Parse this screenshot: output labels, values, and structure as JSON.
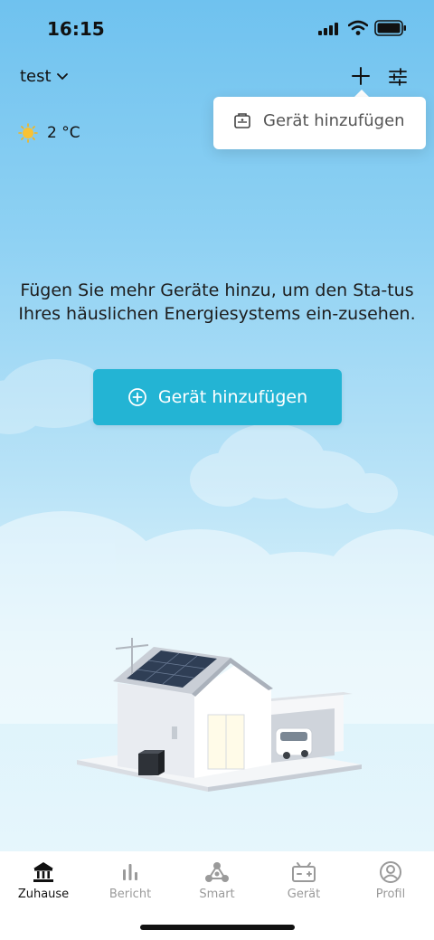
{
  "status_bar": {
    "time": "16:15"
  },
  "header": {
    "home_name": "test"
  },
  "popup": {
    "item_label": "Gerät hinzufügen"
  },
  "weather": {
    "temperature": "2 °C"
  },
  "main": {
    "message": "Fügen Sie mehr Geräte hinzu, um den Sta-tus Ihres häuslichen Energiesystems ein-zusehen.",
    "add_button_label": "Gerät hinzufügen"
  },
  "tabs": [
    {
      "label": "Zuhause",
      "icon": "home-icon",
      "active": true
    },
    {
      "label": "Bericht",
      "icon": "bar-chart-icon",
      "active": false
    },
    {
      "label": "Smart",
      "icon": "smart-nodes-icon",
      "active": false
    },
    {
      "label": "Gerät",
      "icon": "battery-device-icon",
      "active": false
    },
    {
      "label": "Profil",
      "icon": "profile-icon",
      "active": false
    }
  ],
  "colors": {
    "accent": "#23b4d4",
    "sky_top": "#6fc2ef",
    "sky_bottom": "#eaf7fc"
  }
}
